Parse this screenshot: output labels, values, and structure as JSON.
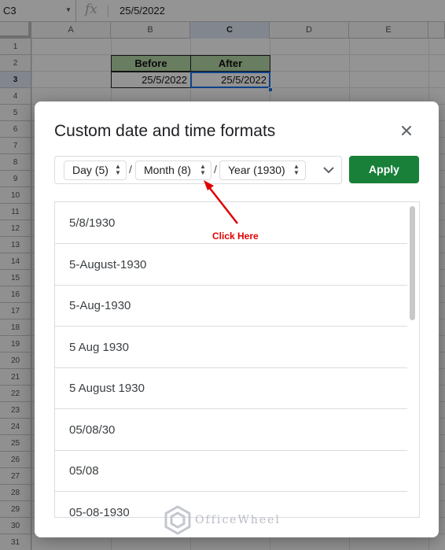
{
  "formula_bar": {
    "cell_ref": "C3",
    "fx_label": "fx",
    "value": "25/5/2022"
  },
  "columns": [
    "A",
    "B",
    "C",
    "D",
    "E"
  ],
  "rows": [
    "1",
    "2",
    "3",
    "4",
    "5",
    "6",
    "7",
    "8",
    "9",
    "10",
    "11",
    "12",
    "13",
    "14",
    "15",
    "16",
    "17",
    "18",
    "19",
    "20",
    "21",
    "22",
    "23",
    "24",
    "25",
    "26",
    "27",
    "28",
    "29",
    "30",
    "31"
  ],
  "cells": {
    "b2": "Before",
    "c2": "After",
    "b3": "25/5/2022",
    "c3": "25/5/2022"
  },
  "dialog": {
    "title": "Custom date and time formats",
    "close_icon": "close-icon",
    "chips": [
      {
        "label": "Day (5)"
      },
      {
        "label": "Month (8)"
      },
      {
        "label": "Year (1930)"
      }
    ],
    "separator": "/",
    "apply_label": "Apply",
    "formats": [
      "5/8/1930",
      "5-August-1930",
      "5-Aug-1930",
      "5 Aug 1930",
      "5 August 1930",
      "05/08/30",
      "05/08",
      "05-08-1930"
    ]
  },
  "annotation": {
    "text": "Click Here",
    "color": "#e00000"
  },
  "watermark": {
    "text": "OfficeWheel"
  },
  "colors": {
    "accent": "#1a73e8",
    "apply": "#188038",
    "header_fill": "#b6d7a8"
  }
}
